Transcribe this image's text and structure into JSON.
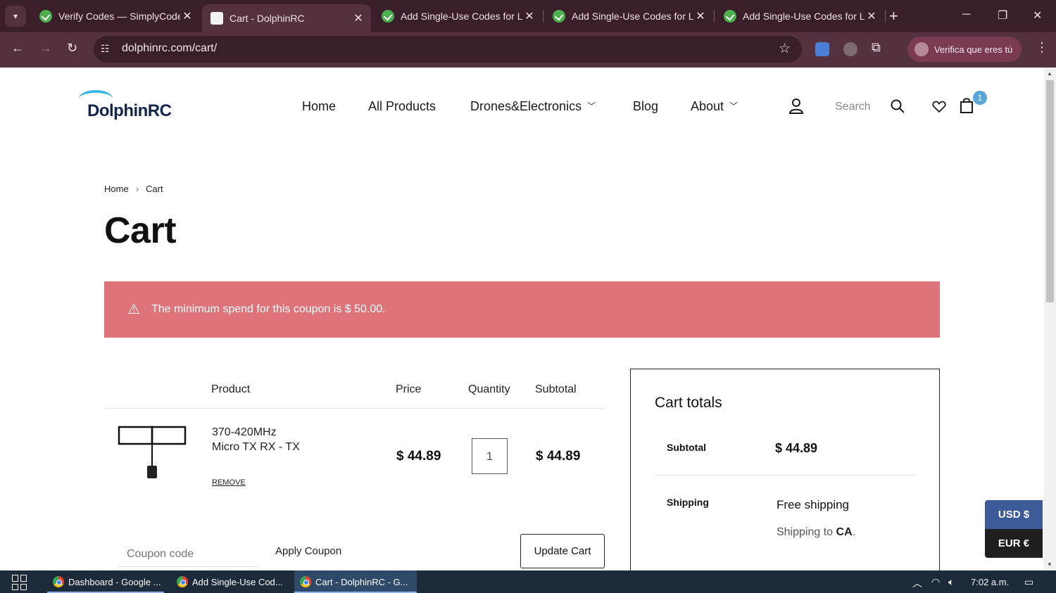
{
  "browser": {
    "tabs": [
      {
        "title": "Verify Codes — SimplyCodes",
        "icon": "simplycodes-check-icon",
        "active": false
      },
      {
        "title": "Cart - DolphinRC",
        "icon": "dolphinrc-icon",
        "active": true
      },
      {
        "title": "Add Single-Use Codes for Le",
        "icon": "simplycodes-check-icon",
        "active": false
      },
      {
        "title": "Add Single-Use Codes for Le",
        "icon": "simplycodes-check-icon",
        "active": false
      },
      {
        "title": "Add Single-Use Codes for Le",
        "icon": "simplycodes-check-icon",
        "active": false
      }
    ],
    "url": "dolphinrc.com/cart/",
    "profile_label": "Verifica que eres tú",
    "accent": "#54313f"
  },
  "site": {
    "logo_text": "DolphinRC",
    "nav": [
      {
        "label": "Home",
        "has_dropdown": false
      },
      {
        "label": "All Products",
        "has_dropdown": false
      },
      {
        "label": "Drones&Electronics",
        "has_dropdown": true
      },
      {
        "label": "Blog",
        "has_dropdown": false
      },
      {
        "label": "About",
        "has_dropdown": true
      }
    ],
    "search_label": "Search",
    "cart_count": "1"
  },
  "breadcrumb": [
    "Home",
    "Cart"
  ],
  "page_title": "Cart",
  "notice": {
    "message": "The minimum spend for this coupon is $ 50.00.",
    "color": "#de7479"
  },
  "cart_table": {
    "headers": [
      "Product",
      "Price",
      "Quantity",
      "Subtotal"
    ],
    "items": [
      {
        "name_line1": "370-420MHz",
        "name_line2": "Micro TX RX - TX",
        "remove_label": "REMOVE",
        "price": "$ 44.89",
        "quantity": "1",
        "subtotal": "$ 44.89"
      }
    ],
    "coupon_placeholder": "Coupon code",
    "apply_label": "Apply Coupon",
    "update_label": "Update Cart"
  },
  "totals": {
    "title": "Cart totals",
    "subtotal_label": "Subtotal",
    "subtotal_value": "$ 44.89",
    "shipping_label": "Shipping",
    "shipping_method": "Free shipping",
    "shipping_to_prefix": "Shipping to ",
    "shipping_to_region": "CA",
    "shipping_to_suffix": "."
  },
  "currency": [
    {
      "label": "USD $",
      "color": "#3d5a99"
    },
    {
      "label": "EUR €",
      "color": "#1e1e1e"
    }
  ],
  "taskbar": {
    "items": [
      {
        "label": "Dashboard - Google ...",
        "active": false
      },
      {
        "label": "Add Single-Use Cod...",
        "active": false
      },
      {
        "label": "Cart - DolphinRC - G...",
        "active": true
      }
    ],
    "clock": "7:02 a.m."
  }
}
